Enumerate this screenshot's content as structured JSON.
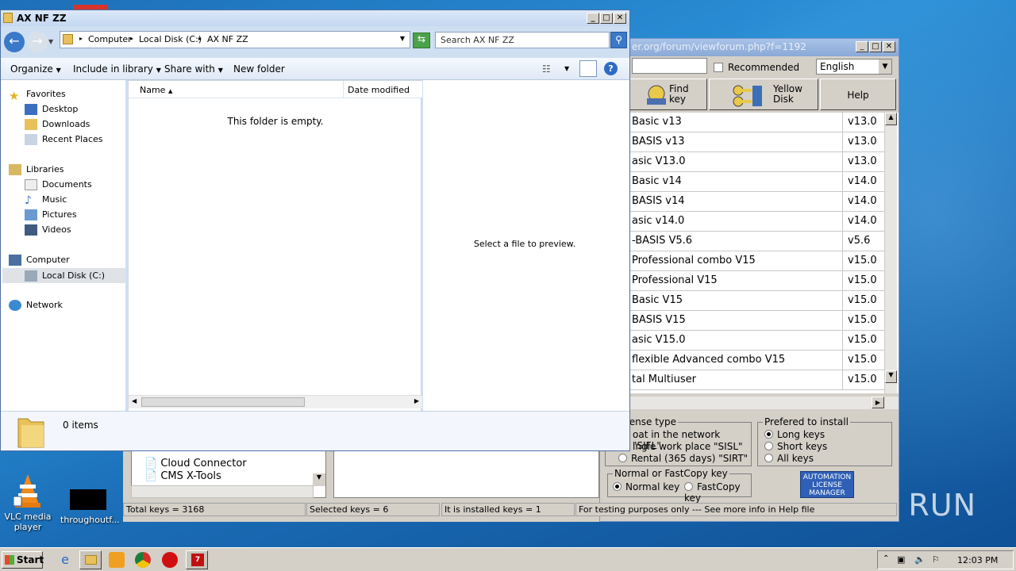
{
  "desktop": {
    "icons": [
      {
        "label": "VLC media player"
      },
      {
        "label": "throughoutf..."
      }
    ],
    "watermark": "ANY RUN"
  },
  "license_manager": {
    "title_fragment": "er.org/forum/viewforum.php?f=1192",
    "recommended_label": "Recommended",
    "language": "English",
    "buttons": {
      "find_key": "Find key",
      "yellow_disk": "Yellow Disk",
      "help": "Help"
    },
    "rows": [
      {
        "name": "Basic v13",
        "version": "v13.0"
      },
      {
        "name": "BASIS v13",
        "version": "v13.0"
      },
      {
        "name": "asic V13.0",
        "version": "v13.0"
      },
      {
        "name": "Basic v14",
        "version": "v14.0"
      },
      {
        "name": "BASIS v14",
        "version": "v14.0"
      },
      {
        "name": "asic v14.0",
        "version": "v14.0"
      },
      {
        "name": "-BASIS V5.6",
        "version": "v5.6"
      },
      {
        "name": "Professional combo V15",
        "version": "v15.0"
      },
      {
        "name": "Professional V15",
        "version": "v15.0"
      },
      {
        "name": "Basic V15",
        "version": "v15.0"
      },
      {
        "name": "BASIS V15",
        "version": "v15.0"
      },
      {
        "name": "asic V15.0",
        "version": "v15.0"
      },
      {
        "name": "flexible Advanced combo V15",
        "version": "v15.0"
      },
      {
        "name": "tal Multiuser",
        "version": "v15.0"
      }
    ],
    "license_type": {
      "legend": "t license type",
      "options": [
        "oat in the network \"SIFL\"",
        "ingle work place \"SISL\"",
        "Rental (365 days) \"SIRT\""
      ]
    },
    "prefer_install": {
      "legend": "Prefered to install",
      "options": [
        "Long keys",
        "Short keys",
        "All keys"
      ],
      "selected": 0
    },
    "copy_mode": {
      "legend": "Normal or FastCopy key",
      "options": [
        "Normal key",
        "FastCopy key"
      ],
      "selected": 0
    },
    "alm_button": "AUTOMATION LICENSE MANAGER",
    "tree_items": [
      "Cloud Connector",
      "CMS X-Tools"
    ],
    "status": {
      "total": "Total keys = 3168",
      "selected": "Selected keys = 6",
      "installed": "It is installed keys = 1",
      "note": "For testing purposes only --- See more info in Help file"
    }
  },
  "explorer": {
    "title": "AX NF ZZ",
    "breadcrumb": [
      "Computer",
      "Local Disk (C:)",
      "AX NF ZZ"
    ],
    "search_placeholder": "Search AX NF ZZ",
    "toolbar": {
      "organize": "Organize",
      "include": "Include in library",
      "share": "Share with",
      "new_folder": "New folder"
    },
    "nav": {
      "favorites": "Favorites",
      "favorites_items": [
        "Desktop",
        "Downloads",
        "Recent Places"
      ],
      "libraries": "Libraries",
      "libraries_items": [
        "Documents",
        "Music",
        "Pictures",
        "Videos"
      ],
      "computer": "Computer",
      "computer_items": [
        "Local Disk (C:)"
      ],
      "network": "Network"
    },
    "columns": {
      "name": "Name",
      "date": "Date modified"
    },
    "empty_text": "This folder is empty.",
    "preview_text": "Select a file to preview.",
    "item_count": "0 items"
  },
  "taskbar": {
    "start": "Start",
    "clock": "12:03 PM"
  }
}
